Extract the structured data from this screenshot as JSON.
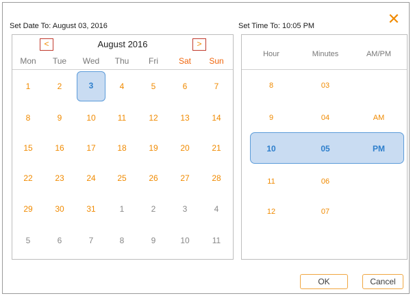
{
  "header": {
    "date_label": "Set Date To: August 03, 2016",
    "time_label": "Set Time To: 10:05 PM"
  },
  "calendar": {
    "title": "August 2016",
    "prev_label": "<",
    "next_label": ">",
    "weekdays": [
      "Mon",
      "Tue",
      "Wed",
      "Thu",
      "Fri",
      "Sat",
      "Sun"
    ],
    "weeks": [
      [
        "1",
        "2",
        "3",
        "4",
        "5",
        "6",
        "7"
      ],
      [
        "8",
        "9",
        "10",
        "11",
        "12",
        "13",
        "14"
      ],
      [
        "15",
        "16",
        "17",
        "18",
        "19",
        "20",
        "21"
      ],
      [
        "22",
        "23",
        "24",
        "25",
        "26",
        "27",
        "28"
      ],
      [
        "29",
        "30",
        "31",
        "1",
        "2",
        "3",
        "4"
      ],
      [
        "5",
        "6",
        "7",
        "8",
        "9",
        "10",
        "11"
      ]
    ],
    "selected_day": "3"
  },
  "time": {
    "columns": [
      "Hour",
      "Minutes",
      "AM/PM"
    ],
    "hours": [
      "8",
      "9",
      "10",
      "11",
      "12"
    ],
    "minutes": [
      "03",
      "04",
      "05",
      "06",
      "07"
    ],
    "ampm": [
      "AM",
      "PM"
    ],
    "selected": {
      "hour": "10",
      "minute": "05",
      "ampm": "PM"
    }
  },
  "buttons": {
    "ok": "OK",
    "cancel": "Cancel"
  },
  "colors": {
    "accent": "#f08a00",
    "weekend": "#f0650c",
    "selected_fill": "#c9dcf2",
    "selected_border": "#5b9bd9",
    "selected_text": "#2e7fcc"
  },
  "icons": {
    "close": "close-icon"
  }
}
